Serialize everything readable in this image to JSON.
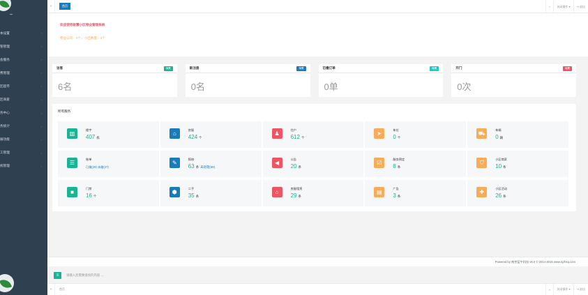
{
  "sidebar": {
    "items": [
      {
        "label": "本设置"
      },
      {
        "label": "管管理"
      },
      {
        "label": "会服务"
      },
      {
        "label": "费管理"
      },
      {
        "label": "区超市"
      },
      {
        "label": "区商家"
      },
      {
        "label": "务中心"
      },
      {
        "label": "务统计"
      },
      {
        "label": "展功能"
      },
      {
        "label": "工管理"
      },
      {
        "label": "统管理"
      }
    ],
    "arrow": "‹"
  },
  "topbar": {
    "back": "«",
    "active_tab": "首页",
    "forward": "»",
    "close_ops": "关闭操作 ▾",
    "logout": "⇥ 退出"
  },
  "welcome": {
    "line1": "欢迎使用智慧小区物业管理系统",
    "line2": "物业公司：0个，小区数量：3个"
  },
  "stats": [
    {
      "label": "访客",
      "badge": "今天",
      "value": "6名",
      "color": "#1ab394"
    },
    {
      "label": "新注册",
      "badge": "今天",
      "value": "0名",
      "color": "#1a7bb9"
    },
    {
      "label": "已缴订单",
      "badge": "今天",
      "value": "0单",
      "color": "#23c6c8"
    },
    {
      "label": "开门",
      "badge": "今天",
      "value": "0次",
      "color": "#ed5565"
    }
  ],
  "services": {
    "title": "所有服务",
    "items": [
      {
        "name": "楼宇",
        "value": "407",
        "unit": "栋",
        "icon": "building-icon",
        "glyph": "▥",
        "color": "#1ab394"
      },
      {
        "name": "房屋",
        "value": "424",
        "unit": "个",
        "icon": "home-icon",
        "glyph": "⌂",
        "color": "#1a7bb9"
      },
      {
        "name": "住户",
        "value": "612",
        "unit": "个",
        "icon": "user-icon",
        "glyph": "♟",
        "color": "#ed5565"
      },
      {
        "name": "车位",
        "value": "0",
        "unit": "个",
        "icon": "location-arrow-icon",
        "glyph": "➤",
        "color": "#f8ac59"
      },
      {
        "name": "车辆",
        "value": "0",
        "unit": "辆",
        "icon": "car-icon",
        "glyph": "⛟",
        "color": "#f8ac59"
      },
      {
        "name": "账单",
        "sub": "已缴(29) 未缴(27)",
        "icon": "list-icon",
        "glyph": "☰",
        "color": "#1ab394"
      },
      {
        "name": "报修",
        "value": "63",
        "unit": "条",
        "sub2": "未处理(59)",
        "icon": "wrench-icon",
        "glyph": "✎",
        "color": "#1a7bb9"
      },
      {
        "name": "公告",
        "value": "20",
        "unit": "条",
        "icon": "bullhorn-icon",
        "glyph": "◀",
        "color": "#ed5565"
      },
      {
        "name": "服务预定",
        "value": "8",
        "unit": "条",
        "icon": "calendar-check-icon",
        "glyph": "☑",
        "color": "#f8ac59"
      },
      {
        "name": "小区商家",
        "value": "10",
        "unit": "条",
        "icon": "cart-icon",
        "glyph": "⛉",
        "color": "#f8ac59"
      },
      {
        "name": "门禁",
        "value": "16",
        "unit": "个",
        "icon": "lock-icon",
        "glyph": "🔒",
        "color": "#1ab394"
      },
      {
        "name": "二手",
        "value": "35",
        "unit": "条",
        "icon": "cube-icon",
        "glyph": "⬢",
        "color": "#1a7bb9"
      },
      {
        "name": "房屋租赁",
        "value": "29",
        "unit": "条",
        "icon": "bank-icon",
        "glyph": "⌂",
        "color": "#ed5565"
      },
      {
        "name": "广告",
        "value": "3",
        "unit": "条",
        "icon": "newspaper-icon",
        "glyph": "▤",
        "color": "#f8ac59"
      },
      {
        "name": "小区活动",
        "value": "26",
        "unit": "条",
        "icon": "gift-icon",
        "glyph": "✚",
        "color": "#f8ac59"
      }
    ]
  },
  "footer": {
    "text": "Powered by 南京蓝牛科技 v8.0 © 2014-2015 www.njzhsq.com"
  },
  "search": {
    "button": "≡",
    "placeholder": "请输入您需要查找的内容 ..."
  }
}
